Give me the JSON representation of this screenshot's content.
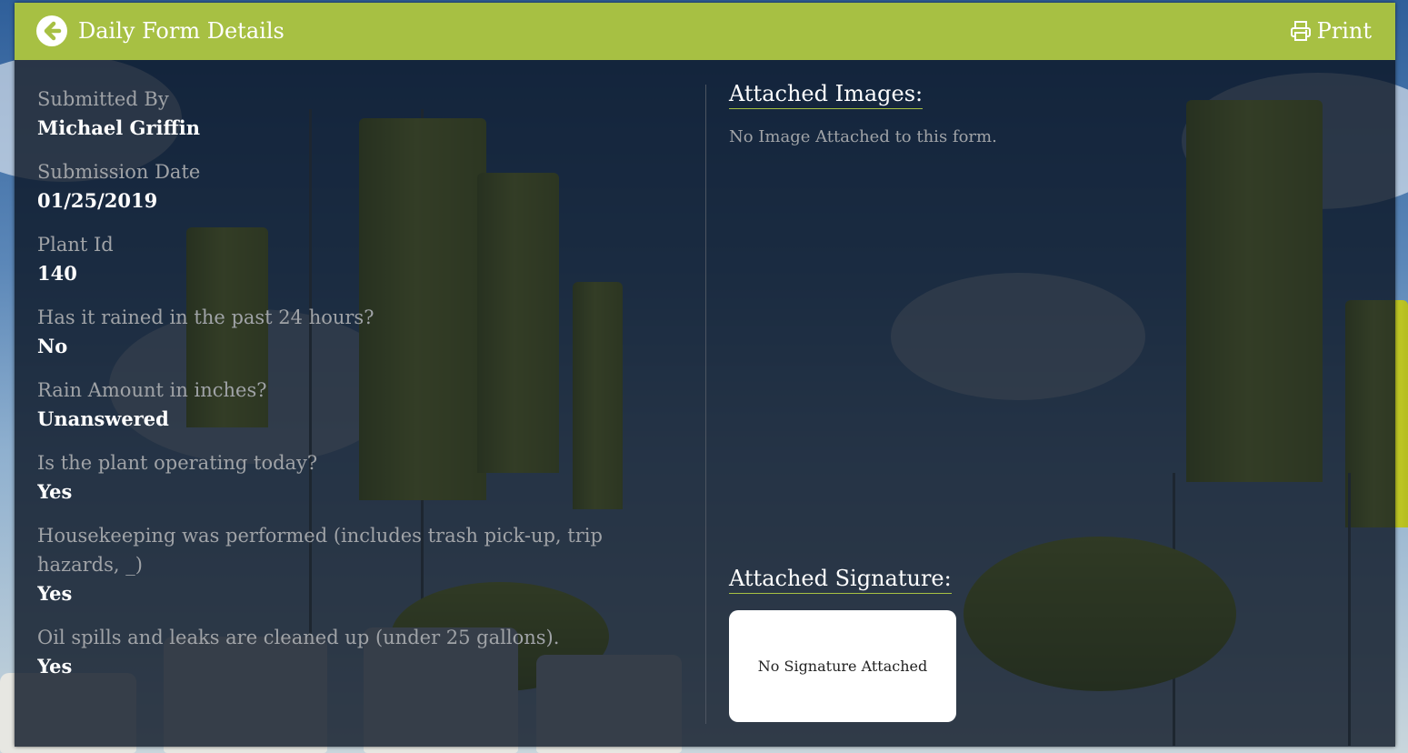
{
  "header": {
    "title": "Daily Form Details",
    "print_label": "Print"
  },
  "fields": [
    {
      "label": "Submitted By",
      "value": "Michael Griffin"
    },
    {
      "label": "Submission Date",
      "value": "01/25/2019"
    },
    {
      "label": "Plant Id",
      "value": "140"
    },
    {
      "label": "Has it rained in the past 24 hours?",
      "value": "No"
    },
    {
      "label": "Rain Amount in inches?",
      "value": "Unanswered"
    },
    {
      "label": "Is the plant operating today?",
      "value": "Yes"
    },
    {
      "label": "Housekeeping was performed (includes trash pick-up, trip hazards, _)",
      "value": "Yes"
    },
    {
      "label": "Oil spills and leaks are cleaned up (under 25 gallons).",
      "value": "Yes"
    }
  ],
  "attachments": {
    "images_heading": "Attached Images:",
    "no_images_text": "No Image Attached to this form.",
    "signature_heading": "Attached Signature:",
    "no_signature_text": "No Signature Attached"
  },
  "icons": {
    "back": "arrow-left-circle-icon",
    "print": "printer-icon"
  },
  "colors": {
    "header": "#a7c043",
    "panel": "rgba(10,20,35,0.80)",
    "label": "#a0a3a7",
    "value": "#ffffff"
  }
}
